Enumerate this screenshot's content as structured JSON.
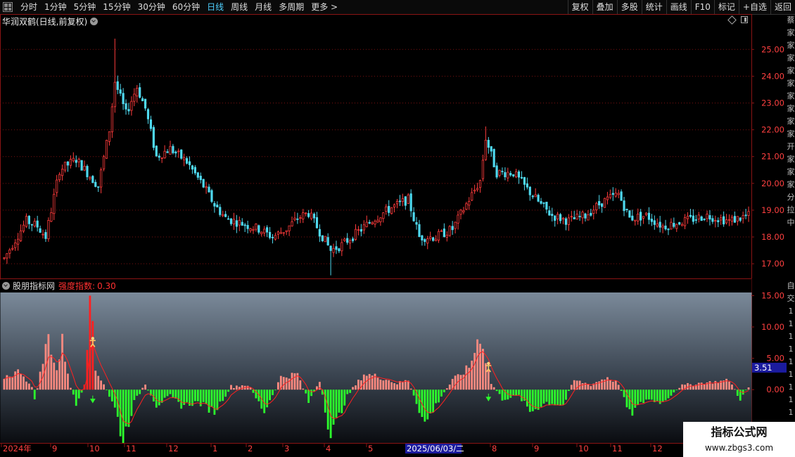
{
  "toolbar": {
    "periods": [
      {
        "label": "分时",
        "active": false
      },
      {
        "label": "1分钟",
        "active": false
      },
      {
        "label": "5分钟",
        "active": false
      },
      {
        "label": "15分钟",
        "active": false
      },
      {
        "label": "30分钟",
        "active": false
      },
      {
        "label": "60分钟",
        "active": false
      },
      {
        "label": "日线",
        "active": true
      },
      {
        "label": "周线",
        "active": false
      },
      {
        "label": "月线",
        "active": false
      },
      {
        "label": "多周期",
        "active": false
      },
      {
        "label": "更多",
        "active": false
      }
    ],
    "more_arrow": ">",
    "right_buttons": [
      "复权",
      "叠加",
      "多股",
      "统计",
      "画线",
      "F10",
      "标记",
      "+自选",
      "返回"
    ]
  },
  "stock": {
    "title": "华润双鹤(日线,前复权)"
  },
  "indicator": {
    "name": "股朋指标网",
    "label": "强度指数:",
    "value": "0.30",
    "current_badge": "3.51"
  },
  "right_strip_chars": [
    "蔡",
    "家",
    "家",
    "家",
    "家",
    "家",
    "家",
    "家",
    "家",
    "家",
    "开",
    "家",
    "家",
    "家",
    "分",
    "拉",
    "中"
  ],
  "right_strip2_chars": [
    "自",
    "交",
    "1",
    "1",
    "1",
    "1",
    "1",
    "1",
    "1",
    "1",
    "1",
    "1"
  ],
  "watermark": {
    "line1": "指标公式网",
    "line2": "www.zbgs3.com"
  },
  "colors": {
    "up": "#ff3b3b",
    "down": "#4fd9ef",
    "pos_bar": "#ff8a80",
    "neg_bar": "#2cff2c",
    "grid": "#7a1010",
    "axis_label": "#ff4040",
    "line": "#ff2020"
  },
  "chart_data": [
    {
      "type": "candlestick",
      "title": "华润双鹤(日线,前复权)",
      "y_ticks": [
        "25.00",
        "24.00",
        "23.00",
        "22.00",
        "21.00",
        "20.00",
        "19.00",
        "18.00",
        "17.00"
      ],
      "ylim": [
        16.4,
        25.9
      ],
      "x_ticks": [
        "2024年",
        "9",
        "10",
        "11",
        "12",
        "1",
        "2",
        "3",
        "4",
        "5",
        "2025/06/03/二",
        "8",
        "9",
        "10",
        "11",
        "12"
      ],
      "cursor_date": "2025/06/03/二",
      "n_bars": 270,
      "price_path": [
        {
          "i": 0,
          "v": 17.2
        },
        {
          "i": 8,
          "v": 18.6
        },
        {
          "i": 12,
          "v": 18.4
        },
        {
          "i": 15,
          "v": 18.0
        },
        {
          "i": 20,
          "v": 20.5
        },
        {
          "i": 26,
          "v": 20.9
        },
        {
          "i": 30,
          "v": 20.4
        },
        {
          "i": 34,
          "v": 19.9
        },
        {
          "i": 38,
          "v": 22.0
        },
        {
          "i": 40,
          "v": 23.8
        },
        {
          "i": 44,
          "v": 22.6
        },
        {
          "i": 48,
          "v": 23.6
        },
        {
          "i": 51,
          "v": 22.8
        },
        {
          "i": 55,
          "v": 21.0
        },
        {
          "i": 60,
          "v": 21.3
        },
        {
          "i": 66,
          "v": 20.8
        },
        {
          "i": 72,
          "v": 19.9
        },
        {
          "i": 76,
          "v": 19.2
        },
        {
          "i": 80,
          "v": 18.7
        },
        {
          "i": 86,
          "v": 18.5
        },
        {
          "i": 92,
          "v": 18.3
        },
        {
          "i": 97,
          "v": 18.0
        },
        {
          "i": 102,
          "v": 18.3
        },
        {
          "i": 106,
          "v": 18.7
        },
        {
          "i": 110,
          "v": 18.9
        },
        {
          "i": 114,
          "v": 18.2
        },
        {
          "i": 118,
          "v": 17.5
        },
        {
          "i": 122,
          "v": 17.7
        },
        {
          "i": 128,
          "v": 18.2
        },
        {
          "i": 134,
          "v": 18.7
        },
        {
          "i": 140,
          "v": 19.1
        },
        {
          "i": 146,
          "v": 19.4
        },
        {
          "i": 150,
          "v": 18.0
        },
        {
          "i": 156,
          "v": 18.0
        },
        {
          "i": 162,
          "v": 18.3
        },
        {
          "i": 168,
          "v": 19.4
        },
        {
          "i": 172,
          "v": 20.1
        },
        {
          "i": 174,
          "v": 21.7
        },
        {
          "i": 178,
          "v": 20.4
        },
        {
          "i": 184,
          "v": 20.4
        },
        {
          "i": 188,
          "v": 19.9
        },
        {
          "i": 194,
          "v": 19.2
        },
        {
          "i": 198,
          "v": 18.8
        },
        {
          "i": 204,
          "v": 18.6
        },
        {
          "i": 210,
          "v": 18.8
        },
        {
          "i": 216,
          "v": 19.3
        },
        {
          "i": 222,
          "v": 19.6
        },
        {
          "i": 226,
          "v": 18.7
        },
        {
          "i": 232,
          "v": 18.8
        },
        {
          "i": 238,
          "v": 18.4
        },
        {
          "i": 246,
          "v": 18.6
        },
        {
          "i": 254,
          "v": 18.8
        },
        {
          "i": 262,
          "v": 18.6
        },
        {
          "i": 269,
          "v": 18.8
        }
      ]
    },
    {
      "type": "bar",
      "title": "强度指数",
      "y_ticks": [
        "15.00",
        "10.00",
        "5.00",
        "0.00"
      ],
      "ylim": [
        -8.5,
        15.5
      ],
      "current_value": 3.51,
      "n_bars": 270,
      "value_path": [
        {
          "i": 0,
          "v": 2.0
        },
        {
          "i": 6,
          "v": 3.0
        },
        {
          "i": 10,
          "v": 0.2
        },
        {
          "i": 11,
          "v": -1.5
        },
        {
          "i": 13,
          "v": 2.5
        },
        {
          "i": 16,
          "v": 8.5
        },
        {
          "i": 19,
          "v": 3.0
        },
        {
          "i": 21,
          "v": 7.5
        },
        {
          "i": 24,
          "v": 0.5
        },
        {
          "i": 26,
          "v": -2.5
        },
        {
          "i": 29,
          "v": 1.0
        },
        {
          "i": 31,
          "v": 15.0
        },
        {
          "i": 33,
          "v": 3.0
        },
        {
          "i": 36,
          "v": 1.0
        },
        {
          "i": 40,
          "v": -3.0
        },
        {
          "i": 43,
          "v": -8.0
        },
        {
          "i": 47,
          "v": -2.0
        },
        {
          "i": 51,
          "v": 1.0
        },
        {
          "i": 55,
          "v": -2.5
        },
        {
          "i": 60,
          "v": -1.0
        },
        {
          "i": 64,
          "v": -2.5
        },
        {
          "i": 70,
          "v": -2.0
        },
        {
          "i": 76,
          "v": -3.5
        },
        {
          "i": 82,
          "v": 0.5
        },
        {
          "i": 88,
          "v": 0.8
        },
        {
          "i": 94,
          "v": -3.5
        },
        {
          "i": 100,
          "v": 2.0
        },
        {
          "i": 106,
          "v": 2.5
        },
        {
          "i": 110,
          "v": -2.0
        },
        {
          "i": 114,
          "v": 1.5
        },
        {
          "i": 118,
          "v": -7.5
        },
        {
          "i": 124,
          "v": -1.0
        },
        {
          "i": 130,
          "v": 2.5
        },
        {
          "i": 136,
          "v": 2.0
        },
        {
          "i": 142,
          "v": 1.0
        },
        {
          "i": 146,
          "v": 1.5
        },
        {
          "i": 152,
          "v": -5.5
        },
        {
          "i": 158,
          "v": -1.0
        },
        {
          "i": 162,
          "v": 1.5
        },
        {
          "i": 168,
          "v": 3.5
        },
        {
          "i": 172,
          "v": 9.0
        },
        {
          "i": 176,
          "v": 1.0
        },
        {
          "i": 180,
          "v": -1.5
        },
        {
          "i": 186,
          "v": -1.0
        },
        {
          "i": 190,
          "v": -3.5
        },
        {
          "i": 196,
          "v": -2.0
        },
        {
          "i": 202,
          "v": -2.5
        },
        {
          "i": 206,
          "v": 1.5
        },
        {
          "i": 212,
          "v": 0.8
        },
        {
          "i": 218,
          "v": 2.0
        },
        {
          "i": 222,
          "v": 1.0
        },
        {
          "i": 226,
          "v": -4.0
        },
        {
          "i": 232,
          "v": -1.5
        },
        {
          "i": 238,
          "v": -2.0
        },
        {
          "i": 244,
          "v": 0.5
        },
        {
          "i": 250,
          "v": 1.0
        },
        {
          "i": 256,
          "v": 1.2
        },
        {
          "i": 262,
          "v": 1.5
        },
        {
          "i": 266,
          "v": -1.5
        },
        {
          "i": 269,
          "v": 0.3
        }
      ]
    }
  ]
}
